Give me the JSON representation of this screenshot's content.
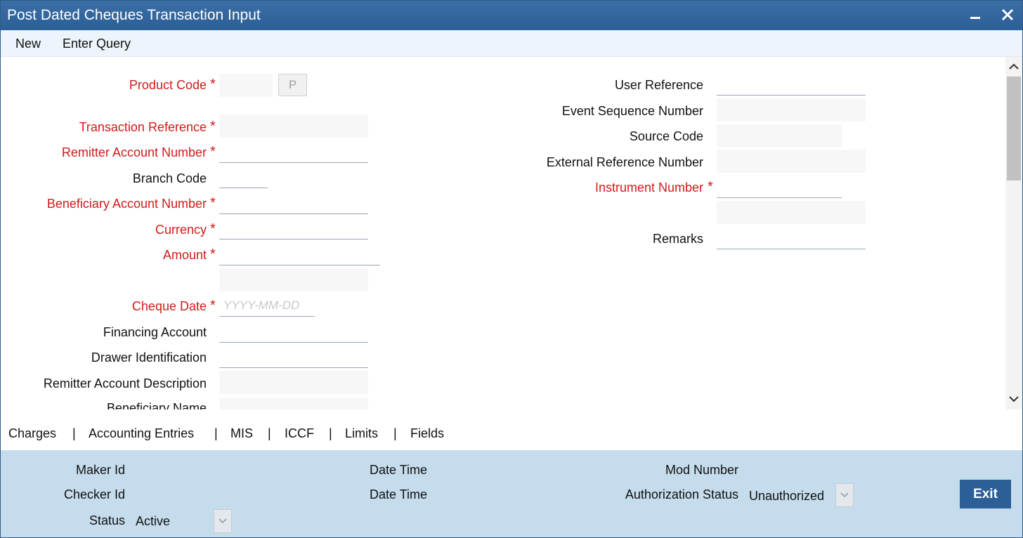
{
  "window": {
    "title": "Post Dated Cheques Transaction Input",
    "minimize_icon": "minimize-icon",
    "close_icon": "close-icon"
  },
  "menu": {
    "items": [
      "New",
      "Enter Query"
    ]
  },
  "left_form": {
    "product_code": {
      "label": "Product Code",
      "button": "P"
    },
    "transaction_reference": {
      "label": "Transaction Reference"
    },
    "remitter_account_number": {
      "label": "Remitter Account Number"
    },
    "branch_code": {
      "label": "Branch Code"
    },
    "beneficiary_account_number": {
      "label": "Beneficiary Account Number"
    },
    "currency": {
      "label": "Currency"
    },
    "amount": {
      "label": "Amount"
    },
    "cheque_date": {
      "label": "Cheque Date",
      "placeholder": "YYYY-MM-DD"
    },
    "financing_account": {
      "label": "Financing Account"
    },
    "drawer_identification": {
      "label": "Drawer Identification"
    },
    "remitter_account_description": {
      "label": "Remitter Account Description"
    },
    "beneficiary_name": {
      "label": "Beneficiary Name"
    }
  },
  "right_form": {
    "user_reference": {
      "label": "User Reference"
    },
    "event_sequence_number": {
      "label": "Event Sequence Number"
    },
    "source_code": {
      "label": "Source Code"
    },
    "external_reference_number": {
      "label": "External Reference Number"
    },
    "instrument_number": {
      "label": "Instrument Number"
    },
    "remarks": {
      "label": "Remarks"
    }
  },
  "required_marker": "*",
  "tabs": [
    "Charges",
    "Accounting Entries",
    "MIS",
    "ICCF",
    "Limits",
    "Fields"
  ],
  "tab_separator": "|",
  "footer": {
    "maker_id_label": "Maker Id",
    "checker_id_label": "Checker Id",
    "status_label": "Status",
    "status_value": "Active",
    "date_time_label_1": "Date Time",
    "date_time_label_2": "Date Time",
    "mod_number_label": "Mod Number",
    "authorization_status_label": "Authorization Status",
    "authorization_status_value": "Unauthorized",
    "exit_label": "Exit"
  },
  "colors": {
    "titlebar": "#2b5f96",
    "required_label": "#d11a1a",
    "footer_bg": "#c5dcec",
    "exit_button": "#2b5f96"
  }
}
